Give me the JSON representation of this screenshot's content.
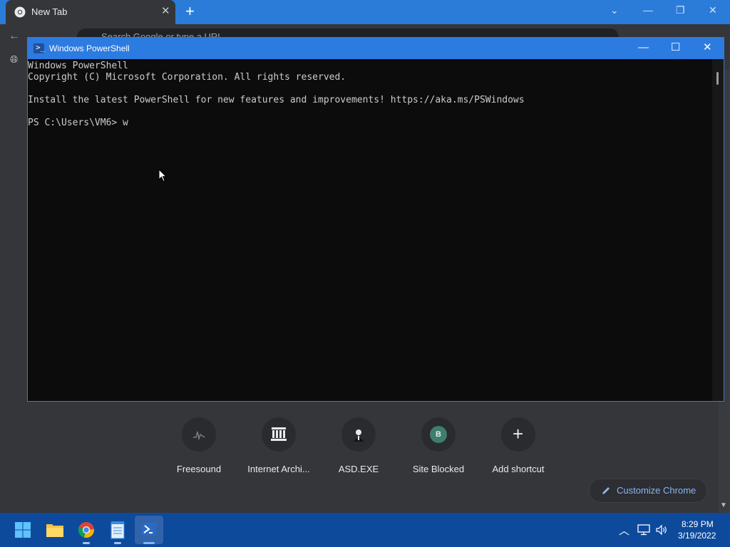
{
  "chrome": {
    "tab_title": "New Tab",
    "tab_close": "✕",
    "new_tab": "+",
    "minimize": "—",
    "maximize": "❐",
    "close": "✕",
    "dropdown": "⌄",
    "omnibox_placeholder": "Search Google or type a URL"
  },
  "shortcuts": [
    {
      "label": "Freesound",
      "icon": "freesound-icon"
    },
    {
      "label": "Internet Archi...",
      "icon": "internet-archive-icon"
    },
    {
      "label": "ASD.EXE",
      "icon": "asd-exe-icon"
    },
    {
      "label": "Site Blocked",
      "icon": "letter-b-icon",
      "letter": "B"
    },
    {
      "label": "Add shortcut",
      "icon": "plus-icon",
      "glyph": "+"
    }
  ],
  "customize_label": "Customize Chrome",
  "powershell": {
    "title": "Windows PowerShell",
    "lines": [
      "Windows PowerShell",
      "Copyright (C) Microsoft Corporation. All rights reserved.",
      "",
      "Install the latest PowerShell for new features and improvements! https://aka.ms/PSWindows",
      "",
      "PS C:\\Users\\VM6> w"
    ],
    "minimize": "—",
    "maximize": "☐",
    "close": "✕"
  },
  "taskbar": {
    "items": [
      "start-icon",
      "file-explorer-icon",
      "chrome-icon",
      "notepad-icon",
      "powershell-icon"
    ],
    "time": "8:29 PM",
    "date": "3/19/2022",
    "tray_chevron": "^"
  },
  "colors": {
    "titlebar": "#2b7cd8",
    "powershell_titlebar": "#2c7be0",
    "console_bg": "#0c0c0c",
    "taskbar": "#0e4a9b",
    "link_blue": "#8ab4f8"
  }
}
